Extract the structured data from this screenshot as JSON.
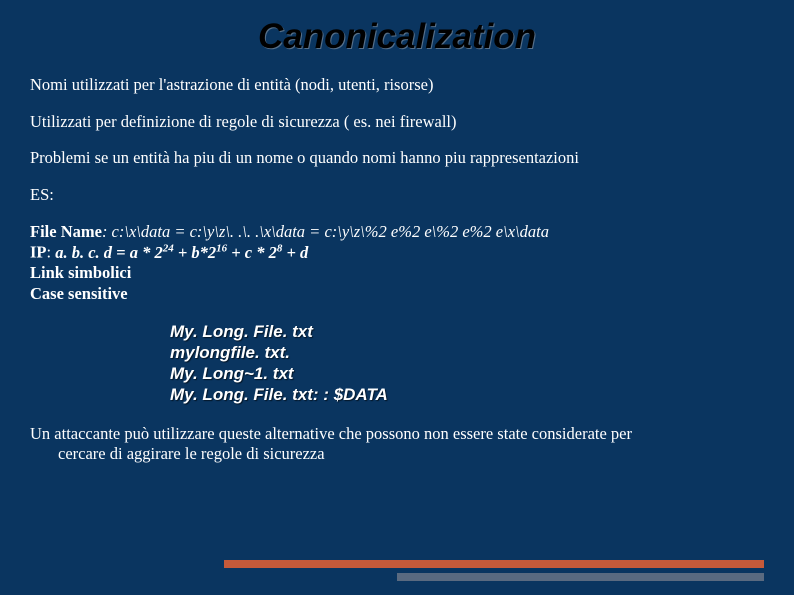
{
  "title": "Canonicalization",
  "paragraphs": {
    "p1": "Nomi utilizzati per l'astrazione di entità (nodi, utenti, risorse)",
    "p2": "Utilizzati per definizione di regole di sicurezza ( es. nei firewall)",
    "p3": "Problemi se un entità ha piu di un nome o quando nomi hanno piu rappresentazioni",
    "p4": "ES:"
  },
  "tech": {
    "file_label": "File Name",
    "file_value": ": c:\\x\\data = c:\\y\\z\\. .\\. .\\x\\data = c:\\y\\z\\%2 e%2 e\\%2 e%2 e\\x\\data",
    "ip_label": "IP",
    "ip_prefix": ": ",
    "ip_abcd": "a. b. c. d = a * 2",
    "ip_exp1": "24",
    "ip_mid1": " + b*2",
    "ip_exp2": "16",
    "ip_mid2": " + c * 2",
    "ip_exp3": "8",
    "ip_tail": " + d",
    "link": "Link simbolici",
    "case": "Case sensitive"
  },
  "files": {
    "f1": "My. Long. File. txt",
    "f2": "mylongfile. txt.",
    "f3": "My. Long~1. txt",
    "f4": "My. Long. File. txt: : $DATA"
  },
  "closing": {
    "l1": "Un attaccante può utilizzare queste alternative che possono non essere state considerate per",
    "l2": "cercare di aggirare le regole di sicurezza"
  }
}
